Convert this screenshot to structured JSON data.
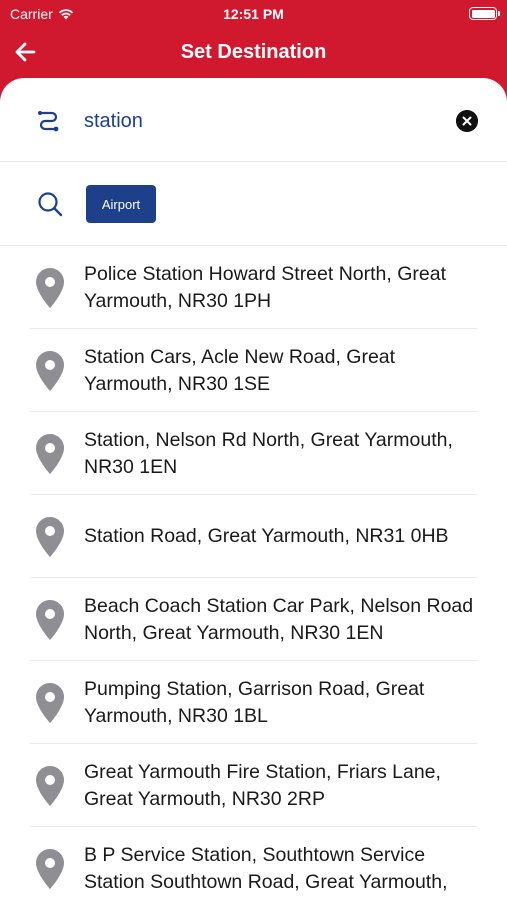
{
  "status": {
    "carrier": "Carrier",
    "time": "12:51 PM",
    "battery": 1.0
  },
  "nav": {
    "title": "Set Destination"
  },
  "search": {
    "value": "station",
    "placeholder": ""
  },
  "filter": {
    "chip_label": "Airport"
  },
  "results": [
    {
      "label": "Police Station Howard Street North, Great Yarmouth, NR30 1PH"
    },
    {
      "label": "Station Cars, Acle New Road, Great Yarmouth, NR30 1SE"
    },
    {
      "label": "Station, Nelson Rd North, Great Yarmouth, NR30 1EN"
    },
    {
      "label": "Station Road, Great Yarmouth, NR31 0HB"
    },
    {
      "label": "Beach Coach Station Car Park, Nelson Road North, Great Yarmouth, NR30 1EN"
    },
    {
      "label": "Pumping Station, Garrison Road, Great Yarmouth, NR30 1BL"
    },
    {
      "label": "Great Yarmouth Fire Station, Friars Lane, Great Yarmouth, NR30 2RP"
    },
    {
      "label": "B P Service Station, Southtown Service Station Southtown Road, Great Yarmouth,"
    }
  ],
  "colors": {
    "header": "#d0182e",
    "accent": "#1e3f8a",
    "pin": "#8e8e93"
  },
  "icons": {
    "back": "arrow-left-icon",
    "route": "route-icon",
    "clear": "close-icon",
    "search": "search-icon",
    "pin": "map-pin-icon",
    "wifi": "wifi-icon",
    "battery": "battery-icon"
  }
}
